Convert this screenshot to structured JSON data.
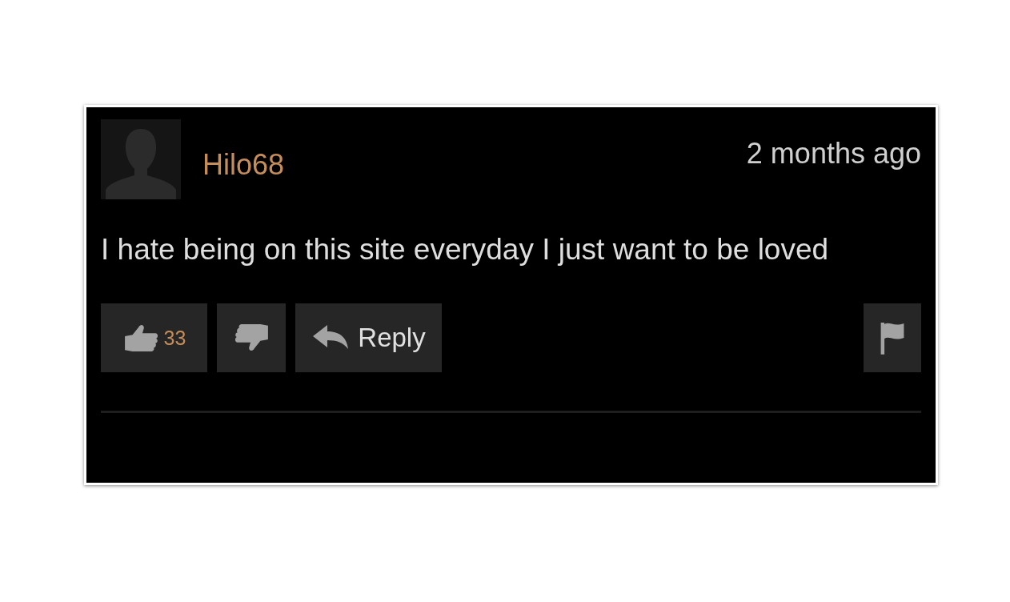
{
  "comment": {
    "username": "Hilo68",
    "time": "2 months ago",
    "text": "I hate being on this site everyday I just want to be loved",
    "likes": "33",
    "reply_label": "Reply"
  }
}
